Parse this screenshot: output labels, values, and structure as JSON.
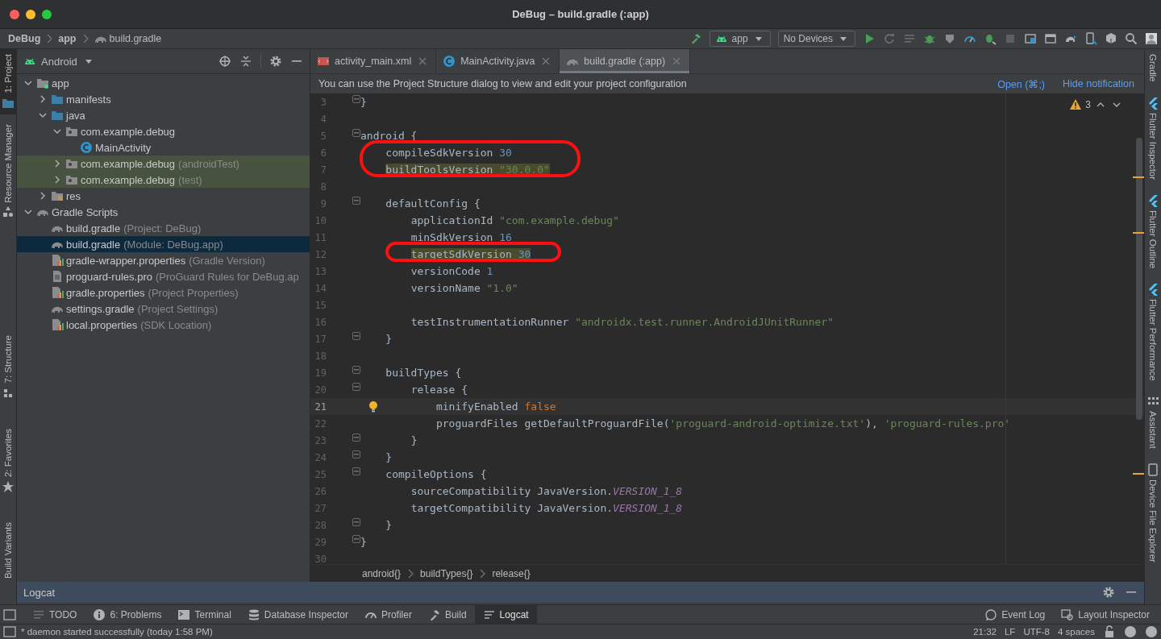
{
  "window": {
    "title": "DeBug – build.gradle (:app)"
  },
  "navbar": {
    "breadcrumbs": [
      {
        "label": "DeBug",
        "kind": "project"
      },
      {
        "label": "app",
        "kind": "module"
      },
      {
        "label": "build.gradle",
        "kind": "gradle"
      }
    ],
    "run_config": "app",
    "device": "No Devices"
  },
  "left_strip": {
    "top": [
      {
        "label": "1: Project",
        "kind": "project",
        "selected": true
      },
      {
        "label": "Resource Manager",
        "kind": "resource",
        "selected": false
      }
    ],
    "bottom": [
      {
        "label": "7: Structure",
        "kind": "structure",
        "selected": false
      },
      {
        "label": "2: Favorites",
        "kind": "favorites",
        "selected": false
      },
      {
        "label": "Build Variants",
        "kind": "plain",
        "selected": false
      }
    ]
  },
  "project_panel": {
    "view": "Android",
    "tree": [
      {
        "label": "app",
        "kind": "module",
        "expanded": true,
        "selected": false,
        "tinted": false,
        "children": [
          {
            "label": "manifests",
            "kind": "folder",
            "expanded": false,
            "selected": false,
            "tinted": false
          },
          {
            "label": "java",
            "kind": "folder",
            "expanded": true,
            "selected": false,
            "tinted": false,
            "children": [
              {
                "label": "com.example.debug",
                "kind": "package",
                "expanded": true,
                "selected": false,
                "tinted": false,
                "children": [
                  {
                    "label": "MainActivity",
                    "kind": "class",
                    "selected": false,
                    "tinted": false
                  }
                ]
              },
              {
                "label": "com.example.debug",
                "note": "(androidTest)",
                "kind": "package",
                "expanded": false,
                "selected": false,
                "tinted": true
              },
              {
                "label": "com.example.debug",
                "note": "(test)",
                "kind": "package",
                "expanded": false,
                "selected": false,
                "tinted": true
              }
            ]
          },
          {
            "label": "res",
            "kind": "res",
            "expanded": false,
            "selected": false,
            "tinted": false
          }
        ]
      },
      {
        "label": "Gradle Scripts",
        "kind": "gradle",
        "expanded": true,
        "selected": false,
        "tinted": false,
        "children": [
          {
            "label": "build.gradle",
            "note": "(Project: DeBug)",
            "kind": "gradle",
            "selected": false,
            "tinted": false
          },
          {
            "label": "build.gradle",
            "note": "(Module: DeBug.app)",
            "kind": "gradle",
            "selected": true,
            "tinted": false
          },
          {
            "label": "gradle-wrapper.properties",
            "note": "(Gradle Version)",
            "kind": "properties",
            "selected": false,
            "tinted": false
          },
          {
            "label": "proguard-rules.pro",
            "note": "(ProGuard Rules for DeBug.ap",
            "kind": "file",
            "selected": false,
            "tinted": false
          },
          {
            "label": "gradle.properties",
            "note": "(Project Properties)",
            "kind": "properties",
            "selected": false,
            "tinted": false
          },
          {
            "label": "settings.gradle",
            "note": "(Project Settings)",
            "kind": "gradle",
            "selected": false,
            "tinted": false
          },
          {
            "label": "local.properties",
            "note": "(SDK Location)",
            "kind": "properties",
            "selected": false,
            "tinted": false
          }
        ]
      }
    ]
  },
  "tabs": [
    {
      "label": "activity_main.xml",
      "kind": "xml",
      "selected": false
    },
    {
      "label": "MainActivity.java",
      "kind": "class",
      "selected": false
    },
    {
      "label": "build.gradle (:app)",
      "kind": "gradle",
      "selected": true
    }
  ],
  "notification": {
    "text": "You can use the Project Structure dialog to view and edit your project configuration",
    "actions": [
      "Open (⌘;)",
      "Hide notification"
    ]
  },
  "editor": {
    "warning_count": "3",
    "lines": [
      {
        "n": "3",
        "code": [
          {
            "text": "}",
            "kind": "plain",
            "highlighted": false
          }
        ],
        "fold": true,
        "circled": false,
        "current": false,
        "bulb": false
      },
      {
        "n": "4",
        "fold": false,
        "circled": false,
        "current": false,
        "bulb": false
      },
      {
        "n": "5",
        "code": [
          {
            "text": "android {",
            "kind": "plain",
            "highlighted": false
          }
        ],
        "fold": true,
        "circled": false,
        "current": false,
        "bulb": false
      },
      {
        "n": "6",
        "code": [
          {
            "text": "    compileSdkVersion ",
            "kind": "plain",
            "highlighted": false
          },
          {
            "text": "30",
            "kind": "num",
            "highlighted": false
          }
        ],
        "fold": false,
        "circled": true,
        "current": false,
        "bulb": false
      },
      {
        "n": "7",
        "code": [
          {
            "text": "    buildToolsVersion ",
            "kind": "plain",
            "highlighted": true
          },
          {
            "text": "\"30.0.0\"",
            "kind": "str",
            "highlighted": true
          }
        ],
        "fold": false,
        "circled": true,
        "current": false,
        "bulb": false
      },
      {
        "n": "8",
        "fold": false,
        "circled": false,
        "current": false,
        "bulb": false
      },
      {
        "n": "9",
        "code": [
          {
            "text": "    defaultConfig {",
            "kind": "plain",
            "highlighted": false
          }
        ],
        "fold": true,
        "circled": false,
        "current": false,
        "bulb": false
      },
      {
        "n": "10",
        "code": [
          {
            "text": "        applicationId ",
            "kind": "plain",
            "highlighted": false
          },
          {
            "text": "\"com.example.debug\"",
            "kind": "str",
            "highlighted": false
          }
        ],
        "fold": false,
        "circled": false,
        "current": false,
        "bulb": false
      },
      {
        "n": "11",
        "code": [
          {
            "text": "        minSdkVersion ",
            "kind": "plain",
            "highlighted": false
          },
          {
            "text": "16",
            "kind": "num",
            "highlighted": false
          }
        ],
        "fold": false,
        "circled": false,
        "current": false,
        "bulb": false
      },
      {
        "n": "12",
        "code": [
          {
            "text": "        targetSdkVersion ",
            "kind": "plain",
            "highlighted": true
          },
          {
            "text": "30",
            "kind": "num",
            "highlighted": true
          }
        ],
        "fold": false,
        "circled": true,
        "current": false,
        "bulb": false
      },
      {
        "n": "13",
        "code": [
          {
            "text": "        versionCode ",
            "kind": "plain",
            "highlighted": false
          },
          {
            "text": "1",
            "kind": "num",
            "highlighted": false
          }
        ],
        "fold": false,
        "circled": false,
        "current": false,
        "bulb": false
      },
      {
        "n": "14",
        "code": [
          {
            "text": "        versionName ",
            "kind": "plain",
            "highlighted": false
          },
          {
            "text": "\"1.0\"",
            "kind": "str",
            "highlighted": false
          }
        ],
        "fold": false,
        "circled": false,
        "current": false,
        "bulb": false
      },
      {
        "n": "15",
        "fold": false,
        "circled": false,
        "current": false,
        "bulb": false
      },
      {
        "n": "16",
        "code": [
          {
            "text": "        testInstrumentationRunner ",
            "kind": "plain",
            "highlighted": false
          },
          {
            "text": "\"androidx.test.runner.AndroidJUnitRunner\"",
            "kind": "str",
            "highlighted": false
          }
        ],
        "fold": false,
        "circled": false,
        "current": false,
        "bulb": false
      },
      {
        "n": "17",
        "code": [
          {
            "text": "    }",
            "kind": "plain",
            "highlighted": false
          }
        ],
        "fold": true,
        "circled": false,
        "current": false,
        "bulb": false
      },
      {
        "n": "18",
        "fold": false,
        "circled": false,
        "current": false,
        "bulb": false
      },
      {
        "n": "19",
        "code": [
          {
            "text": "    buildTypes {",
            "kind": "plain",
            "highlighted": false
          }
        ],
        "fold": true,
        "circled": false,
        "current": false,
        "bulb": false
      },
      {
        "n": "20",
        "code": [
          {
            "text": "        release {",
            "kind": "plain",
            "highlighted": false
          }
        ],
        "fold": true,
        "circled": false,
        "current": false,
        "bulb": false
      },
      {
        "n": "21",
        "code": [
          {
            "text": "            minifyEnabled ",
            "kind": "plain",
            "highlighted": false
          },
          {
            "text": "false",
            "kind": "kw",
            "highlighted": false
          }
        ],
        "fold": false,
        "circled": false,
        "current": true,
        "bulb": true
      },
      {
        "n": "22",
        "code": [
          {
            "text": "            proguardFiles getDefaultProguardFile(",
            "kind": "plain",
            "highlighted": false
          },
          {
            "text": "'proguard-android-optimize.txt'",
            "kind": "str",
            "highlighted": false
          },
          {
            "text": "), ",
            "kind": "plain",
            "highlighted": false
          },
          {
            "text": "'proguard-rules.pro'",
            "kind": "str",
            "highlighted": false
          }
        ],
        "fold": false,
        "circled": false,
        "current": false,
        "bulb": false
      },
      {
        "n": "23",
        "code": [
          {
            "text": "        }",
            "kind": "plain",
            "highlighted": false
          }
        ],
        "fold": true,
        "circled": false,
        "current": false,
        "bulb": false
      },
      {
        "n": "24",
        "code": [
          {
            "text": "    }",
            "kind": "plain",
            "highlighted": false
          }
        ],
        "fold": true,
        "circled": false,
        "current": false,
        "bulb": false
      },
      {
        "n": "25",
        "code": [
          {
            "text": "    compileOptions {",
            "kind": "plain",
            "highlighted": false
          }
        ],
        "fold": true,
        "circled": false,
        "current": false,
        "bulb": false
      },
      {
        "n": "26",
        "code": [
          {
            "text": "        sourceCompatibility JavaVersion.",
            "kind": "plain",
            "highlighted": false
          },
          {
            "text": "VERSION_1_8",
            "kind": "const",
            "highlighted": false
          }
        ],
        "fold": false,
        "circled": false,
        "current": false,
        "bulb": false
      },
      {
        "n": "27",
        "code": [
          {
            "text": "        targetCompatibility JavaVersion.",
            "kind": "plain",
            "highlighted": false
          },
          {
            "text": "VERSION_1_8",
            "kind": "const",
            "highlighted": false
          }
        ],
        "fold": false,
        "circled": false,
        "current": false,
        "bulb": false
      },
      {
        "n": "28",
        "code": [
          {
            "text": "    }",
            "kind": "plain",
            "highlighted": false
          }
        ],
        "fold": true,
        "circled": false,
        "current": false,
        "bulb": false
      },
      {
        "n": "29",
        "code": [
          {
            "text": "}",
            "kind": "plain",
            "highlighted": false
          }
        ],
        "fold": true,
        "circled": false,
        "current": false,
        "bulb": false
      },
      {
        "n": "30",
        "fold": false,
        "circled": false,
        "current": false,
        "bulb": false
      }
    ],
    "breadcrumbs": [
      "android{}",
      "buildTypes{}",
      "release{}"
    ]
  },
  "right_strip": [
    {
      "label": "Gradle",
      "kind": "gradle"
    },
    {
      "label": "Flutter Inspector",
      "kind": "flutter"
    },
    {
      "label": "Flutter Outline",
      "kind": "flutter"
    },
    {
      "label": "Flutter Performance",
      "kind": "flutter"
    },
    {
      "label": "Assistant",
      "kind": "assistant"
    },
    {
      "label": "Device File Explorer",
      "kind": "device"
    }
  ],
  "logcat": {
    "title": "Logcat"
  },
  "tool_bar": {
    "left": [
      {
        "label": "TODO",
        "kind": "list",
        "selected": false
      },
      {
        "label": "6: Problems",
        "kind": "problems",
        "selected": false
      },
      {
        "label": "Terminal",
        "kind": "terminal",
        "selected": false
      },
      {
        "label": "Database Inspector",
        "kind": "database",
        "selected": false
      },
      {
        "label": "Profiler",
        "kind": "gauge",
        "selected": false
      },
      {
        "label": "Build",
        "kind": "hammer",
        "selected": false
      },
      {
        "label": "Logcat",
        "kind": "logcat",
        "selected": true
      }
    ],
    "right": [
      {
        "label": "Event Log",
        "kind": "bubble"
      },
      {
        "label": "Layout Inspector",
        "kind": "layout"
      }
    ]
  },
  "status_bar": {
    "message": "* daemon started successfully (today 1:58 PM)",
    "items": [
      "21:32",
      "LF",
      "UTF-8",
      "4 spaces"
    ]
  }
}
